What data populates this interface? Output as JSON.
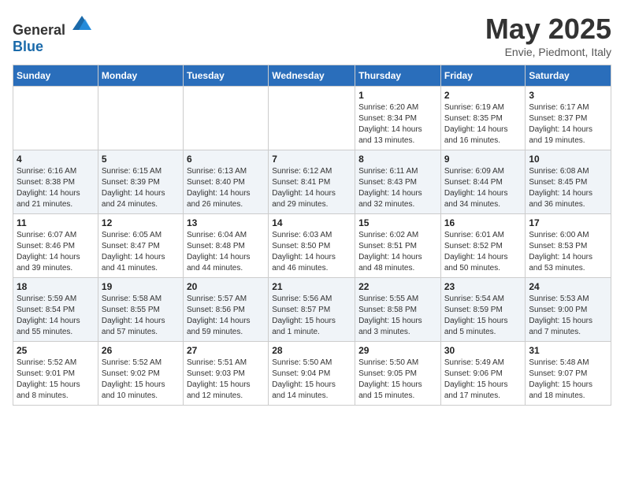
{
  "header": {
    "logo": {
      "general": "General",
      "blue": "Blue"
    },
    "month": "May 2025",
    "location": "Envie, Piedmont, Italy"
  },
  "weekdays": [
    "Sunday",
    "Monday",
    "Tuesday",
    "Wednesday",
    "Thursday",
    "Friday",
    "Saturday"
  ],
  "weeks": [
    [
      {
        "day": "",
        "info": ""
      },
      {
        "day": "",
        "info": ""
      },
      {
        "day": "",
        "info": ""
      },
      {
        "day": "",
        "info": ""
      },
      {
        "day": "1",
        "info": "Sunrise: 6:20 AM\nSunset: 8:34 PM\nDaylight: 14 hours\nand 13 minutes."
      },
      {
        "day": "2",
        "info": "Sunrise: 6:19 AM\nSunset: 8:35 PM\nDaylight: 14 hours\nand 16 minutes."
      },
      {
        "day": "3",
        "info": "Sunrise: 6:17 AM\nSunset: 8:37 PM\nDaylight: 14 hours\nand 19 minutes."
      }
    ],
    [
      {
        "day": "4",
        "info": "Sunrise: 6:16 AM\nSunset: 8:38 PM\nDaylight: 14 hours\nand 21 minutes."
      },
      {
        "day": "5",
        "info": "Sunrise: 6:15 AM\nSunset: 8:39 PM\nDaylight: 14 hours\nand 24 minutes."
      },
      {
        "day": "6",
        "info": "Sunrise: 6:13 AM\nSunset: 8:40 PM\nDaylight: 14 hours\nand 26 minutes."
      },
      {
        "day": "7",
        "info": "Sunrise: 6:12 AM\nSunset: 8:41 PM\nDaylight: 14 hours\nand 29 minutes."
      },
      {
        "day": "8",
        "info": "Sunrise: 6:11 AM\nSunset: 8:43 PM\nDaylight: 14 hours\nand 32 minutes."
      },
      {
        "day": "9",
        "info": "Sunrise: 6:09 AM\nSunset: 8:44 PM\nDaylight: 14 hours\nand 34 minutes."
      },
      {
        "day": "10",
        "info": "Sunrise: 6:08 AM\nSunset: 8:45 PM\nDaylight: 14 hours\nand 36 minutes."
      }
    ],
    [
      {
        "day": "11",
        "info": "Sunrise: 6:07 AM\nSunset: 8:46 PM\nDaylight: 14 hours\nand 39 minutes."
      },
      {
        "day": "12",
        "info": "Sunrise: 6:05 AM\nSunset: 8:47 PM\nDaylight: 14 hours\nand 41 minutes."
      },
      {
        "day": "13",
        "info": "Sunrise: 6:04 AM\nSunset: 8:48 PM\nDaylight: 14 hours\nand 44 minutes."
      },
      {
        "day": "14",
        "info": "Sunrise: 6:03 AM\nSunset: 8:50 PM\nDaylight: 14 hours\nand 46 minutes."
      },
      {
        "day": "15",
        "info": "Sunrise: 6:02 AM\nSunset: 8:51 PM\nDaylight: 14 hours\nand 48 minutes."
      },
      {
        "day": "16",
        "info": "Sunrise: 6:01 AM\nSunset: 8:52 PM\nDaylight: 14 hours\nand 50 minutes."
      },
      {
        "day": "17",
        "info": "Sunrise: 6:00 AM\nSunset: 8:53 PM\nDaylight: 14 hours\nand 53 minutes."
      }
    ],
    [
      {
        "day": "18",
        "info": "Sunrise: 5:59 AM\nSunset: 8:54 PM\nDaylight: 14 hours\nand 55 minutes."
      },
      {
        "day": "19",
        "info": "Sunrise: 5:58 AM\nSunset: 8:55 PM\nDaylight: 14 hours\nand 57 minutes."
      },
      {
        "day": "20",
        "info": "Sunrise: 5:57 AM\nSunset: 8:56 PM\nDaylight: 14 hours\nand 59 minutes."
      },
      {
        "day": "21",
        "info": "Sunrise: 5:56 AM\nSunset: 8:57 PM\nDaylight: 15 hours\nand 1 minute."
      },
      {
        "day": "22",
        "info": "Sunrise: 5:55 AM\nSunset: 8:58 PM\nDaylight: 15 hours\nand 3 minutes."
      },
      {
        "day": "23",
        "info": "Sunrise: 5:54 AM\nSunset: 8:59 PM\nDaylight: 15 hours\nand 5 minutes."
      },
      {
        "day": "24",
        "info": "Sunrise: 5:53 AM\nSunset: 9:00 PM\nDaylight: 15 hours\nand 7 minutes."
      }
    ],
    [
      {
        "day": "25",
        "info": "Sunrise: 5:52 AM\nSunset: 9:01 PM\nDaylight: 15 hours\nand 8 minutes."
      },
      {
        "day": "26",
        "info": "Sunrise: 5:52 AM\nSunset: 9:02 PM\nDaylight: 15 hours\nand 10 minutes."
      },
      {
        "day": "27",
        "info": "Sunrise: 5:51 AM\nSunset: 9:03 PM\nDaylight: 15 hours\nand 12 minutes."
      },
      {
        "day": "28",
        "info": "Sunrise: 5:50 AM\nSunset: 9:04 PM\nDaylight: 15 hours\nand 14 minutes."
      },
      {
        "day": "29",
        "info": "Sunrise: 5:50 AM\nSunset: 9:05 PM\nDaylight: 15 hours\nand 15 minutes."
      },
      {
        "day": "30",
        "info": "Sunrise: 5:49 AM\nSunset: 9:06 PM\nDaylight: 15 hours\nand 17 minutes."
      },
      {
        "day": "31",
        "info": "Sunrise: 5:48 AM\nSunset: 9:07 PM\nDaylight: 15 hours\nand 18 minutes."
      }
    ]
  ]
}
